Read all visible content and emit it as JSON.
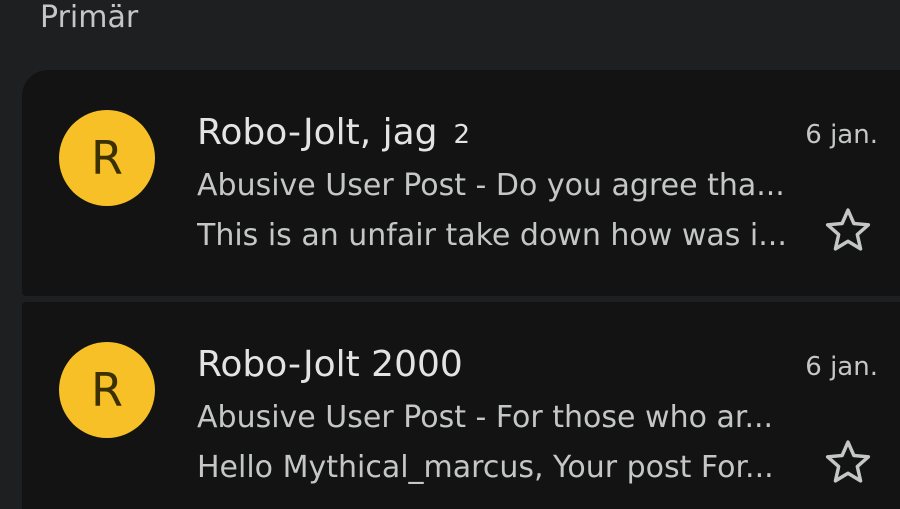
{
  "section": {
    "title": "Primär"
  },
  "emails": [
    {
      "avatar_letter": "R",
      "sender": "Robo-Jolt, jag",
      "count": "2",
      "date": "6 jan.",
      "subject": "Abusive User Post - Do you agree tha...",
      "snippet": "This is an unfair take down how was i...",
      "avatar_color": "#f6c026",
      "star_icon": "star-outline-icon"
    },
    {
      "avatar_letter": "R",
      "sender": "Robo-Jolt 2000",
      "count": "",
      "date": "6 jan.",
      "subject": "Abusive User Post - For those who ar...",
      "snippet": "Hello Mythical_marcus, Your post For...",
      "avatar_color": "#f6c026",
      "star_icon": "star-outline-icon"
    }
  ],
  "colors": {
    "background": "#1e1f20",
    "card": "#131314",
    "text_primary": "#e3e3e3",
    "text_secondary": "#c4c7c5",
    "avatar": "#f6c026"
  }
}
